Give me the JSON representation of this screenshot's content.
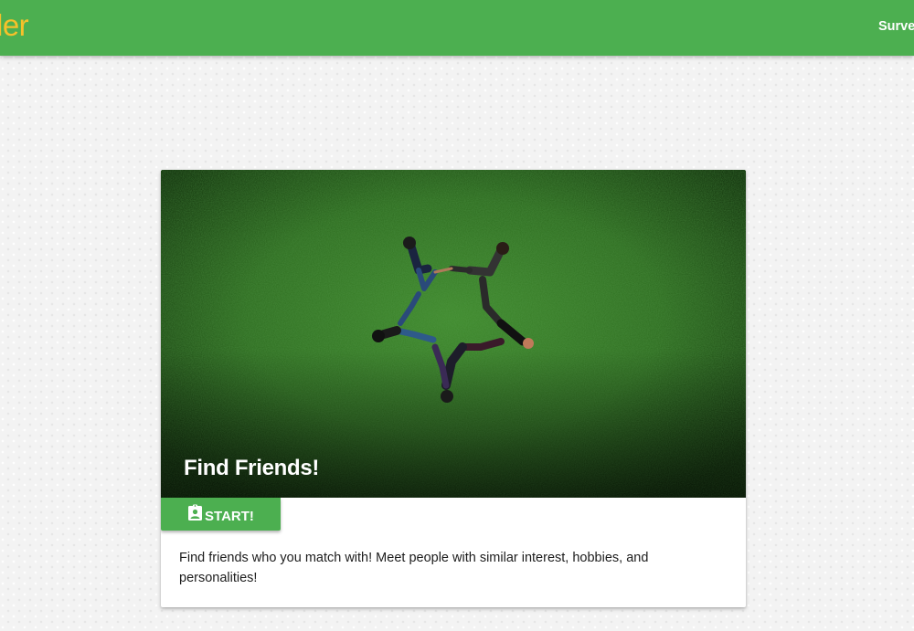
{
  "navbar": {
    "brand": "ler",
    "links": [
      {
        "label": "Survey"
      }
    ],
    "colors": {
      "background": "#4caf50",
      "brand": "#f6c12a"
    }
  },
  "card": {
    "image": {
      "icon": "grass-photo-star-people"
    },
    "title": "Find Friends!",
    "action": {
      "label": "START!",
      "icon": "assignment-ind-icon",
      "color": "#4caf50"
    },
    "content": "Find friends who you match with! Meet people with similar interest, hobbies, and personalities!"
  }
}
